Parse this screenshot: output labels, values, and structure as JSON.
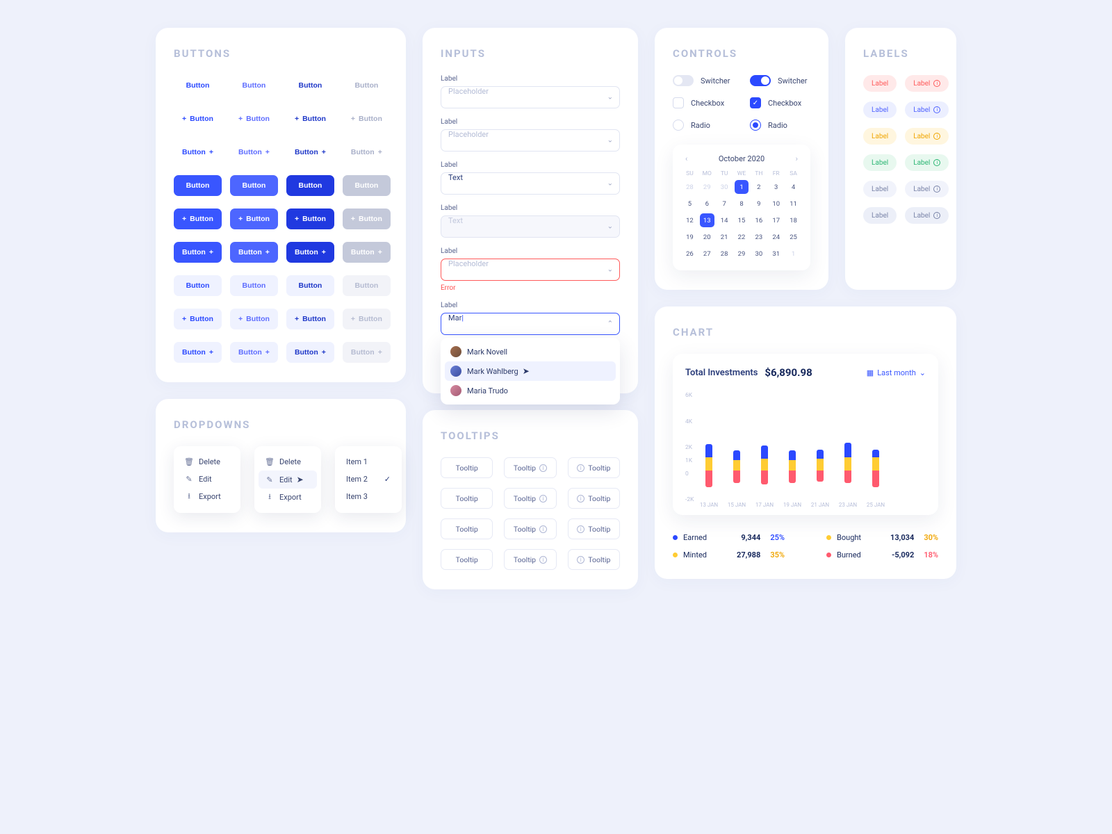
{
  "sections": {
    "buttons_title": "BUTTONS",
    "dropdowns_title": "DROPDOWNS",
    "inputs_title": "INPUTS",
    "tooltips_title": "TOOLTIPS",
    "controls_title": "CONTROLS",
    "labels_title": "LABELS",
    "chart_title": "CHART"
  },
  "buttons": {
    "label": "Button"
  },
  "dropdowns": {
    "menu1": [
      "Delete",
      "Edit",
      "Export"
    ],
    "menu2": [
      "Delete",
      "Edit",
      "Export"
    ],
    "menu3": [
      "Item 1",
      "Item 2",
      "Item 3"
    ]
  },
  "inputs": {
    "label": "Label",
    "placeholder": "Placeholder",
    "text": "Text",
    "error": "Error",
    "search_value": "Mar",
    "autocomplete": [
      "Mark Novell",
      "Mark Wahlberg",
      "Maria Trudo"
    ]
  },
  "tooltips": {
    "label": "Tooltip"
  },
  "controls": {
    "switcher": "Switcher",
    "checkbox": "Checkbox",
    "radio": "Radio"
  },
  "calendar": {
    "month": "October 2020",
    "dow": [
      "SU",
      "MO",
      "TU",
      "WE",
      "TH",
      "FR",
      "SA"
    ],
    "lead": [
      28,
      29,
      30
    ],
    "days_first_row": [
      1,
      2,
      3,
      4
    ],
    "days": [
      5,
      6,
      7,
      8,
      9,
      10,
      11,
      12,
      13,
      14,
      15,
      16,
      17,
      18,
      19,
      20,
      21,
      22,
      23,
      24,
      25,
      26,
      27,
      28,
      29,
      30,
      31
    ],
    "trail": [
      1
    ],
    "today": 1,
    "selected": 13
  },
  "labels": {
    "text": "Label"
  },
  "chart": {
    "title": "Total Investments",
    "value": "$6,890.98",
    "period": "Last month",
    "legend": [
      {
        "name": "Earned",
        "num": "9,344",
        "pct": "25%",
        "pct_color": "blue",
        "dot": "blue"
      },
      {
        "name": "Bought",
        "num": "13,034",
        "pct": "30%",
        "pct_color": "yellow",
        "dot": "yellow"
      },
      {
        "name": "Minted",
        "num": "27,988",
        "pct": "35%",
        "pct_color": "yellow",
        "dot": "yellow"
      },
      {
        "name": "Burned",
        "num": "-5,092",
        "pct": "18%",
        "pct_color": "red",
        "dot": "red"
      }
    ]
  },
  "chart_data": {
    "type": "bar",
    "categories": [
      "13 JAN",
      "15 JAN",
      "17 JAN",
      "19 JAN",
      "21 JAN",
      "23 JAN",
      "25 JAN"
    ],
    "yticks": [
      -2,
      0,
      1,
      2,
      4,
      6
    ],
    "ylabel_suffix": "K",
    "series": [
      {
        "name": "Earned",
        "color": "#2b49ff",
        "values": [
          1.0,
          0.7,
          1.0,
          0.7,
          0.7,
          1.1,
          0.6
        ]
      },
      {
        "name": "Minted",
        "color": "#ffcc33",
        "values": [
          1.0,
          0.8,
          0.9,
          0.8,
          0.9,
          1.0,
          1.0
        ]
      },
      {
        "name": "Burned",
        "color": "#ff5a6e",
        "values": [
          -1.3,
          -1.0,
          -1.1,
          -1.0,
          -0.9,
          -1.0,
          -1.3
        ]
      }
    ],
    "ylim": [
      -2,
      6
    ]
  }
}
